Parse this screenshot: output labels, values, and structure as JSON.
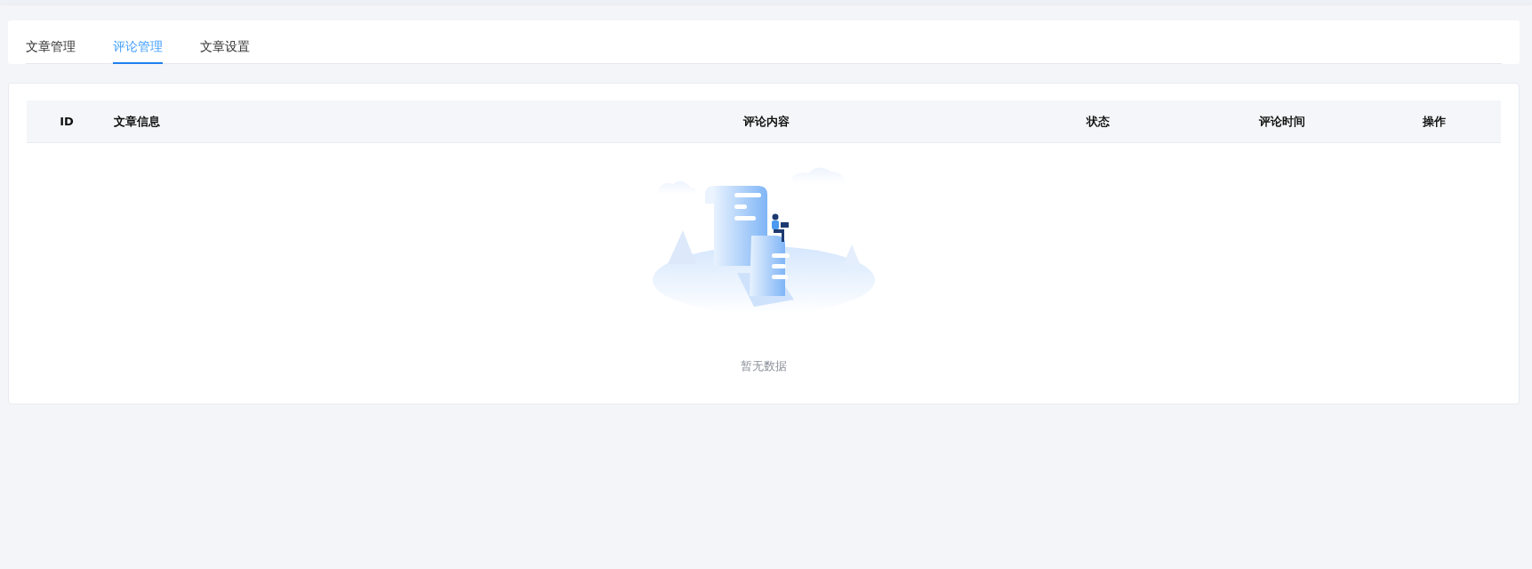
{
  "tabs": [
    {
      "label": "文章管理",
      "selected": false
    },
    {
      "label": "评论管理",
      "selected": true
    },
    {
      "label": "文章设置",
      "selected": false
    }
  ],
  "table": {
    "columns": [
      {
        "label": "ID"
      },
      {
        "label": "文章信息"
      },
      {
        "label": "评论内容"
      },
      {
        "label": "状态"
      },
      {
        "label": "评论时间"
      },
      {
        "label": "操作"
      }
    ],
    "empty_text": "暂无数据"
  }
}
